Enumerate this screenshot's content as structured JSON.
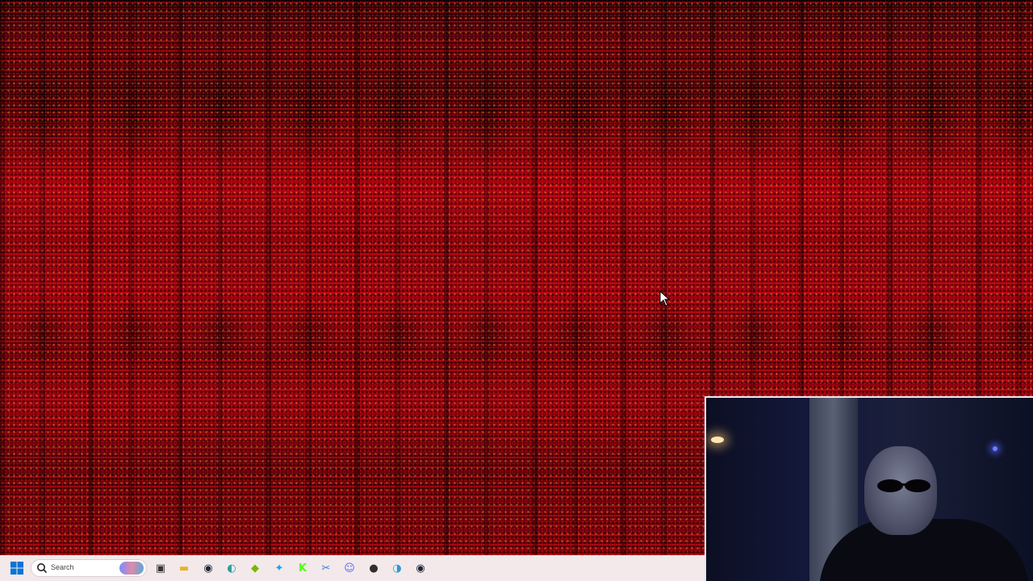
{
  "taskbar": {
    "search_placeholder": "Search",
    "apps": [
      {
        "name": "task-view-icon",
        "glyph": "▣",
        "color": "#333333"
      },
      {
        "name": "file-explorer-icon",
        "glyph": "▬",
        "color": "#e8b32a"
      },
      {
        "name": "steam-icon",
        "glyph": "◉",
        "color": "#1b2838"
      },
      {
        "name": "edge-beta-icon",
        "glyph": "◐",
        "color": "#2f9e9c"
      },
      {
        "name": "nvidia-icon",
        "glyph": "◆",
        "color": "#76b900"
      },
      {
        "name": "twitter-icon",
        "glyph": "✦",
        "color": "#1da1f2"
      },
      {
        "name": "kick-icon",
        "glyph": "K",
        "color": "#53fc18"
      },
      {
        "name": "snipping-tool-icon",
        "glyph": "✂",
        "color": "#3c7bd6"
      },
      {
        "name": "discord-icon",
        "glyph": "☺",
        "color": "#5865f2"
      },
      {
        "name": "obs-icon",
        "glyph": "●",
        "color": "#302e31"
      },
      {
        "name": "edge-icon",
        "glyph": "◑",
        "color": "#2a9ad6"
      },
      {
        "name": "steam-alt-icon",
        "glyph": "◉",
        "color": "#1b2838"
      }
    ]
  },
  "colors": {
    "wallpaper_red": "#b0000f",
    "taskbar_bg": "#f3e9ea",
    "start_blue": "#0a74d6"
  }
}
